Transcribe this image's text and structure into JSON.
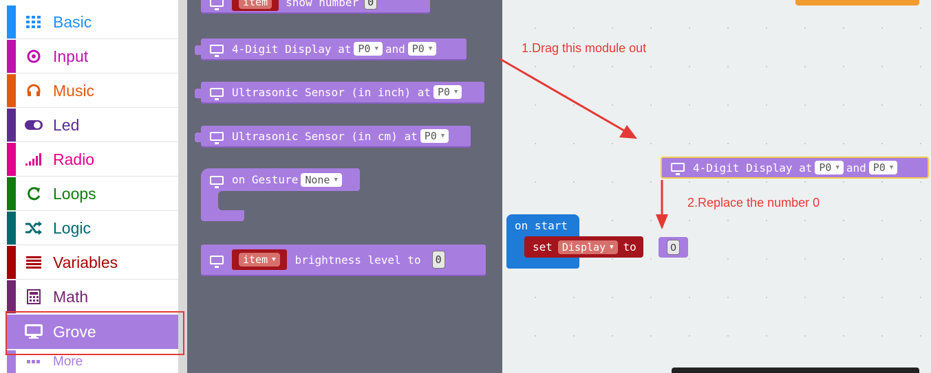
{
  "toolbox": {
    "categories": [
      {
        "label": "Basic",
        "icon": "grid-icon",
        "color": "#1e90ff"
      },
      {
        "label": "Input",
        "icon": "target-icon",
        "color": "#c011ad"
      },
      {
        "label": "Music",
        "icon": "headphones-icon",
        "color": "#e2590e"
      },
      {
        "label": "Led",
        "icon": "toggle-icon",
        "color": "#5c2d91"
      },
      {
        "label": "Radio",
        "icon": "signal-icon",
        "color": "#e3008c"
      },
      {
        "label": "Loops",
        "icon": "refresh-icon",
        "color": "#107c10"
      },
      {
        "label": "Logic",
        "icon": "shuffle-icon",
        "color": "#006970"
      },
      {
        "label": "Variables",
        "icon": "list-icon",
        "color": "#a80000"
      },
      {
        "label": "Math",
        "icon": "calculator-icon",
        "color": "#712672"
      },
      {
        "label": "Grove",
        "icon": "monitor-icon",
        "color": "#a87de0"
      },
      {
        "label": "More",
        "icon": "dots-icon",
        "color": "#a87de0"
      }
    ]
  },
  "flyout": {
    "top_block": {
      "var": "item",
      "text": "show number",
      "value": "0"
    },
    "block_4digit": {
      "text": "4-Digit Display at",
      "pin1": "P0",
      "and": "and",
      "pin2": "P0"
    },
    "block_ultra_inch": {
      "text": "Ultrasonic Sensor (in inch) at",
      "pin": "P0"
    },
    "block_ultra_cm": {
      "text": "Ultrasonic Sensor (in cm) at",
      "pin": "P0"
    },
    "block_gesture": {
      "text": "on Gesture",
      "option": "None"
    },
    "block_brightness": {
      "var": "item",
      "text": "brightness level to",
      "value": "0"
    }
  },
  "workspace": {
    "annotation1": "1.Drag this module out",
    "annotation2": "2.Replace the number 0",
    "on_start": "on start",
    "set_block": {
      "set": "set",
      "var": "Display",
      "to": "to",
      "value": "0"
    },
    "dragged_block": {
      "text": "4-Digit Display at",
      "pin1": "P0",
      "and": "and",
      "pin2": "P0"
    }
  },
  "colors": {
    "annotation": "#e53935",
    "grove": "#a87de0",
    "variables": "#a80000",
    "on_start": "#1e7bd8"
  }
}
